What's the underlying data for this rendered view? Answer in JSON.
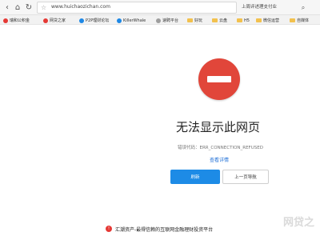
{
  "toolbar": {
    "address_url": "www.huichaozichan.com",
    "back_tab_title": "上周评述理支付业",
    "nav_back_icon": "chevron-left-icon",
    "nav_forward_icon": "chevron-right-icon",
    "home_icon": "home-icon",
    "refresh_icon": "refresh-icon",
    "star_icon": "star-icon",
    "search_icon": "search-icon"
  },
  "bookmarks": [
    {
      "label": "瑞和公积金",
      "icon_color": "#e53935"
    },
    {
      "label": "网贷之家",
      "icon_color": "#e53935"
    },
    {
      "label": "P2P理财论坛",
      "icon_color": "#1e88e5"
    },
    {
      "label": "KillerWhale",
      "icon_color": "#1e88e5"
    },
    {
      "label": "速聘平台",
      "icon_color": "#9e9e9e"
    },
    {
      "label": "好玩",
      "icon_color": "#f2c14e",
      "folder": true
    },
    {
      "label": "云盘",
      "icon_color": "#f2c14e",
      "folder": true
    },
    {
      "label": "H5",
      "icon_color": "#f2c14e",
      "folder": true
    },
    {
      "label": "微信运营",
      "icon_color": "#f2c14e",
      "folder": true
    },
    {
      "label": "自媒体",
      "icon_color": "#f2c14e",
      "folder": true
    }
  ],
  "error": {
    "title": "无法显示此网页",
    "code": "错误代码：ERR_CONNECTION_REFUSED",
    "details_link": "查看详情"
  },
  "buttons": {
    "refresh": "刷新",
    "back": "上一页导航"
  },
  "banner": {
    "text": "汇潮资产-最得信赖的互联网金融理财投资平台",
    "icon_color": "#e53935"
  },
  "watermark": "网贷之"
}
